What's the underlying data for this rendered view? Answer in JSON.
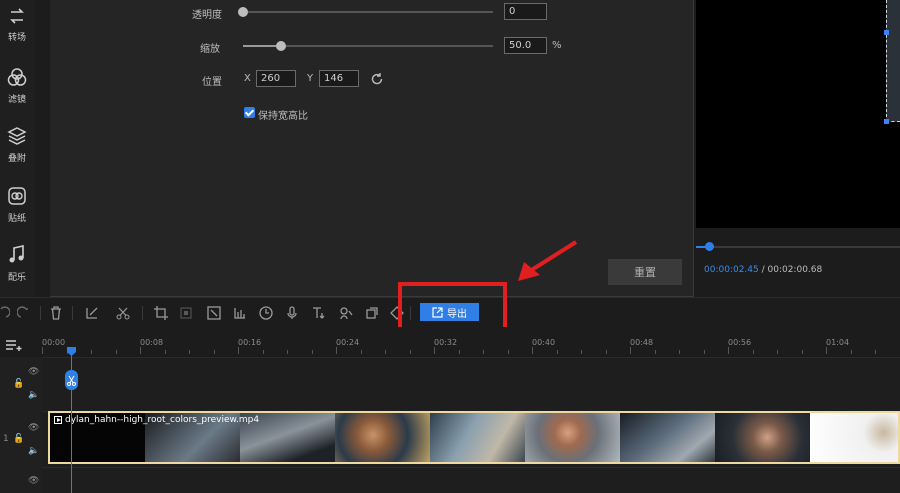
{
  "sidebar": {
    "items": [
      {
        "label": "转场",
        "icon": "transition-icon"
      },
      {
        "label": "滤镜",
        "icon": "filter-icon"
      },
      {
        "label": "叠附",
        "icon": "overlay-icon"
      },
      {
        "label": "贴纸",
        "icon": "sticker-icon"
      },
      {
        "label": "配乐",
        "icon": "music-icon"
      }
    ]
  },
  "properties": {
    "opacity": {
      "label": "透明度",
      "value": "0",
      "level": 0
    },
    "scale": {
      "label": "缩放",
      "value": "50.0",
      "unit": "%",
      "level": 0.15
    },
    "position": {
      "label": "位置",
      "x_label": "X",
      "x_value": "260",
      "y_label": "Y",
      "y_value": "146"
    },
    "keep_ratio": {
      "label": "保持宽高比",
      "checked": true
    },
    "reset_label": "重置"
  },
  "preview": {
    "current_time": "00:00:02.45",
    "separator": " / ",
    "total_time": "00:02:00.68",
    "progress": 0.07
  },
  "toolbar": {
    "export_label": "导出"
  },
  "timeline": {
    "ticks": [
      "00:00",
      "00:08",
      "00:16",
      "00:24",
      "00:32",
      "00:40",
      "00:48",
      "00:56",
      "01:04"
    ],
    "clip_name": "dylan_hahn--high_root_colors_preview.mp4",
    "track1_label": "1"
  },
  "colors": {
    "accent": "#2f7fe6",
    "annotation": "#e02020"
  }
}
